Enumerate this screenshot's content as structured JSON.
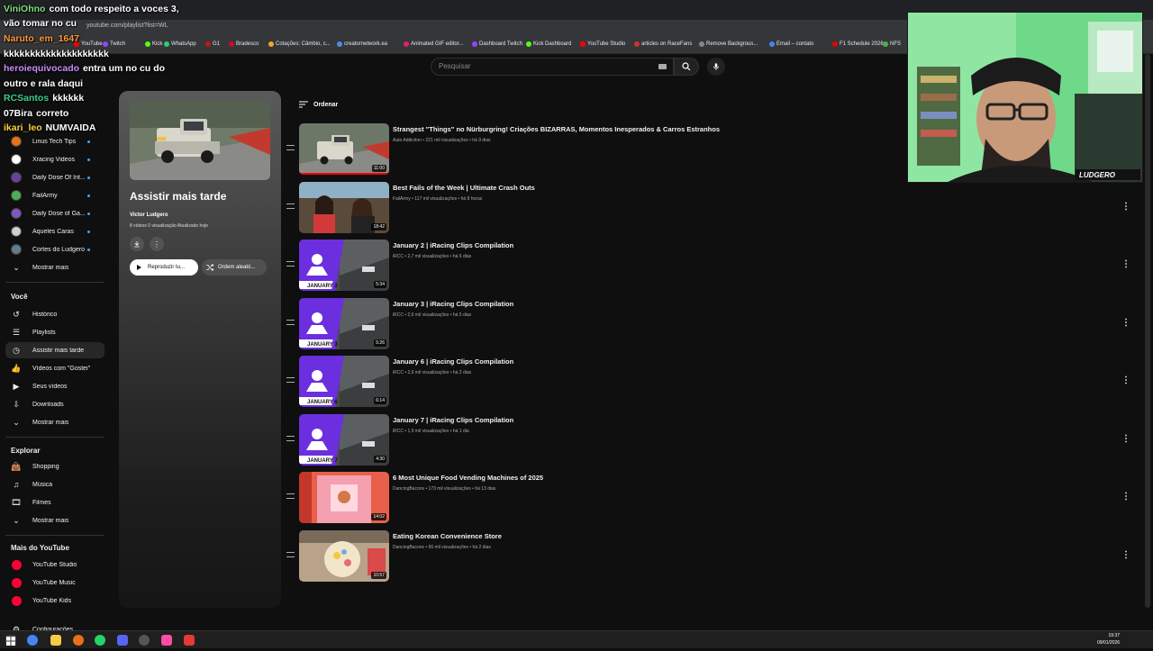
{
  "browser": {
    "url": "youtube.com/playlist?list=WL",
    "bookmarks": [
      {
        "label": "YouTube",
        "color": "#ff0000"
      },
      {
        "label": "Twitch",
        "color": "#9146ff"
      },
      {
        "label": "Kick",
        "color": "#53fc18"
      },
      {
        "label": "WhatsApp",
        "color": "#25d366"
      },
      {
        "label": "G1",
        "color": "#c4170c"
      },
      {
        "label": "Bradesco",
        "color": "#cc092f"
      },
      {
        "label": "Cotações: Câmbio, c...",
        "color": "#f5a623"
      },
      {
        "label": "creatornetwork.ea",
        "color": "#4a90e2"
      },
      {
        "label": "Animated GIF editor...",
        "color": "#e91e63"
      },
      {
        "label": "Dashboard Twitch",
        "color": "#9146ff"
      },
      {
        "label": "Kick Dashboard",
        "color": "#53fc18"
      },
      {
        "label": "YouTube Studio",
        "color": "#ff0000"
      },
      {
        "label": "articles on RaceFans",
        "color": "#d32f2f"
      },
      {
        "label": "Remove Backgrous...",
        "color": "#888888"
      },
      {
        "label": "Email – contato",
        "color": "#4285f4"
      },
      {
        "label": "F1 Schedule 2026",
        "color": "#e10600"
      },
      {
        "label": "NFS",
        "color": "#4caf50"
      }
    ]
  },
  "search": {
    "placeholder": "Pesquisar"
  },
  "sidebar": {
    "subscriptions": [
      {
        "label": "Linus Tech Tips",
        "color": "#e8711a"
      },
      {
        "label": "Xracing Videos",
        "color": "#ffffff"
      },
      {
        "label": "Daily Dose Of Int...",
        "color": "#6b3fa0"
      },
      {
        "label": "FailArmy",
        "color": "#4caf50"
      },
      {
        "label": "Daily Dose of Ga...",
        "color": "#7e57c2"
      },
      {
        "label": "Aqueles Caras",
        "color": "#cfcfcf"
      },
      {
        "label": "Cortes do Ludgero",
        "color": "#607d8b"
      }
    ],
    "subs_more": "Mostrar mais",
    "you_heading": "Você",
    "you_items": [
      {
        "label": "Histórico",
        "icon": "history-icon"
      },
      {
        "label": "Playlists",
        "icon": "playlists-icon"
      },
      {
        "label": "Assistir mais tarde",
        "icon": "watch-later-icon"
      },
      {
        "label": "Vídeos com \"Gostei\"",
        "icon": "like-icon"
      },
      {
        "label": "Seus vídeos",
        "icon": "your-videos-icon"
      },
      {
        "label": "Downloads",
        "icon": "download-icon"
      },
      {
        "label": "Mostrar mais",
        "icon": "chevron-down-icon"
      }
    ],
    "explore_heading": "Explorar",
    "explore_items": [
      {
        "label": "Shopping",
        "icon": "shopping-icon"
      },
      {
        "label": "Música",
        "icon": "music-icon"
      },
      {
        "label": "Filmes",
        "icon": "movies-icon"
      },
      {
        "label": "Mostrar mais",
        "icon": "chevron-down-icon"
      }
    ],
    "more_heading": "Mais do YouTube",
    "more_items": [
      {
        "label": "YouTube Studio"
      },
      {
        "label": "YouTube Music"
      },
      {
        "label": "YouTube Kids"
      }
    ],
    "settings": "Configurações"
  },
  "playlist": {
    "title": "Assistir mais tarde",
    "owner": "Victor Ludgero",
    "meta": "8 vídeos   0 visualização   Atualizado hoje",
    "play_all": "Reproduzir tu...",
    "shuffle": "Ordem aleató..."
  },
  "sort_label": "Ordenar",
  "videos": [
    {
      "title": "Strangest \"Things\" no Nürburgring! Criações BIZARRAS, Momentos Inesperados & Carros Estranhos",
      "meta": "Auto Addiction • 221 mil visualizações • há 9 dias",
      "duration": "11:00",
      "kind": "truck",
      "progress": 1.0
    },
    {
      "title": "Best Fails of the Week | Ultimate Crash Outs",
      "meta": "FailArmy • 117 mil visualizações • há 8 horas",
      "duration": "18:42",
      "kind": "fails",
      "progress": 0
    },
    {
      "title": "January 2 | iRacing Clips Compilation",
      "meta": "iRCC • 2,7 mil visualizações • há 6 dias",
      "duration": "5:34",
      "kind": "iracing",
      "badge": "JANUARY 2",
      "progress": 0
    },
    {
      "title": "January 3 | iRacing Clips Compilation",
      "meta": "iRCC • 2,6 mil visualizações • há 5 dias",
      "duration": "5:26",
      "kind": "iracing",
      "badge": "JANUARY 3",
      "progress": 0
    },
    {
      "title": "January 6 | iRacing Clips Compilation",
      "meta": "iRCC • 2,6 mil visualizações • há 2 dias",
      "duration": "6:14",
      "kind": "iracing",
      "badge": "JANUARY 6",
      "progress": 0
    },
    {
      "title": "January 7 | iRacing Clips Compilation",
      "meta": "iRCC • 1,9 mil visualizações • há 1 dia",
      "duration": "4:30",
      "kind": "iracing",
      "badge": "JANUARY 7",
      "progress": 0
    },
    {
      "title": "6 Most Unique Food Vending Machines of 2025",
      "meta": "DancingBacons • 173 mil visualizações • há 13 dias",
      "duration": "14:02",
      "kind": "vending",
      "progress": 0
    },
    {
      "title": "Eating Korean Convenience Store",
      "meta": "DancingBacons • 96 mil visualizações • há 2 dias",
      "duration": "10:57",
      "kind": "korean",
      "progress": 0
    }
  ],
  "chat": [
    {
      "user": "ViniOhno",
      "color": "#7fe07f",
      "text": "com todo respeito a voces 3,"
    },
    {
      "user": "",
      "color": "#ffffff",
      "text": "vão tomar no cu"
    },
    {
      "user": "Naruto_em_1647",
      "color": "#ff9a3c",
      "text": ""
    },
    {
      "user": "",
      "color": "#ffffff",
      "text": "kkkkkkkkkkkkkkkkkkkk"
    },
    {
      "user": "heroiequivocado",
      "color": "#c98cff",
      "text": "entra um no cu do"
    },
    {
      "user": "",
      "color": "#ffffff",
      "text": "outro e rala daqui"
    },
    {
      "user": "RCSantos",
      "color": "#3ccf8e",
      "text": "kkkkkk"
    },
    {
      "user": "07Bira",
      "color": "#ffffff",
      "text": "correto"
    },
    {
      "user": "ikari_leo",
      "color": "#ffd23f",
      "text": "NUMVAIDA"
    }
  ],
  "webcam": {
    "logo_text": "LUDGERO"
  },
  "clock": {
    "time": "19:37",
    "date": "09/01/2026"
  }
}
